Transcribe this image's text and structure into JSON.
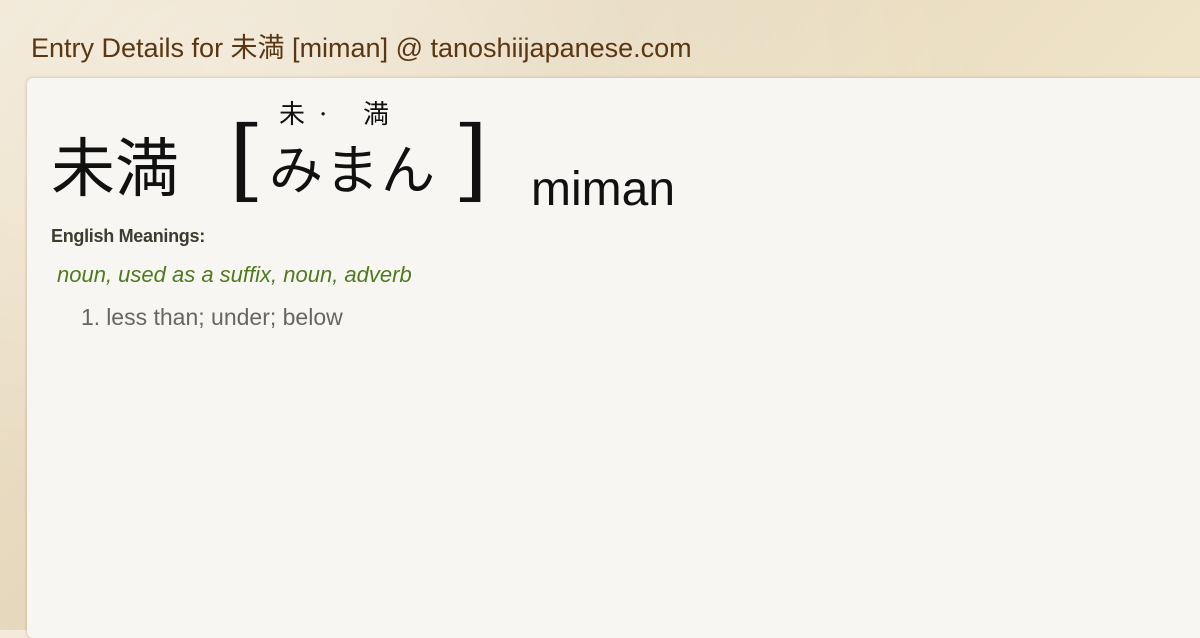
{
  "page": {
    "title": "Entry Details for 未満 [miman] @ tanoshiijapanese.com",
    "background_color": "#efe4cf",
    "card_color": "#f7f6f2",
    "title_color": "#5a3712",
    "pos_color": "#4f7a1f"
  },
  "entry": {
    "kanji": "未満",
    "bracket_open": "[",
    "bracket_close": "]",
    "furigana": [
      "未",
      "·",
      "満"
    ],
    "kana": "みまん",
    "romaji": "miman"
  },
  "meanings": {
    "label": "English Meanings:",
    "parts_of_speech": "noun, used as a suffix, noun, adverb",
    "definitions": [
      {
        "number": "1.",
        "text": "less than; under; below"
      }
    ]
  }
}
